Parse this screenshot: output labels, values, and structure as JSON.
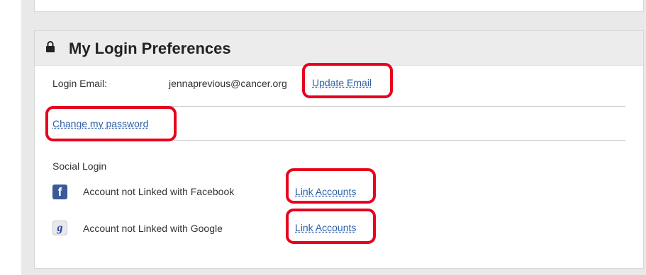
{
  "panel": {
    "title": "My Login Preferences",
    "icon": "lock-icon"
  },
  "login_email": {
    "label": "Login Email:",
    "value": "jennaprevious@cancer.org",
    "update_link": "Update Email"
  },
  "password": {
    "change_link": "Change my password"
  },
  "social": {
    "heading": "Social Login",
    "accounts": [
      {
        "icon": "facebook-icon",
        "glyph": "f",
        "status": "Account not Linked with Facebook",
        "link": "Link Accounts"
      },
      {
        "icon": "google-icon",
        "glyph": "g",
        "status": "Account not Linked with Google",
        "link": "Link Accounts"
      }
    ]
  },
  "colors": {
    "link": "#2d5fa6",
    "highlight": "#e8001c",
    "facebook": "#3b5998"
  }
}
